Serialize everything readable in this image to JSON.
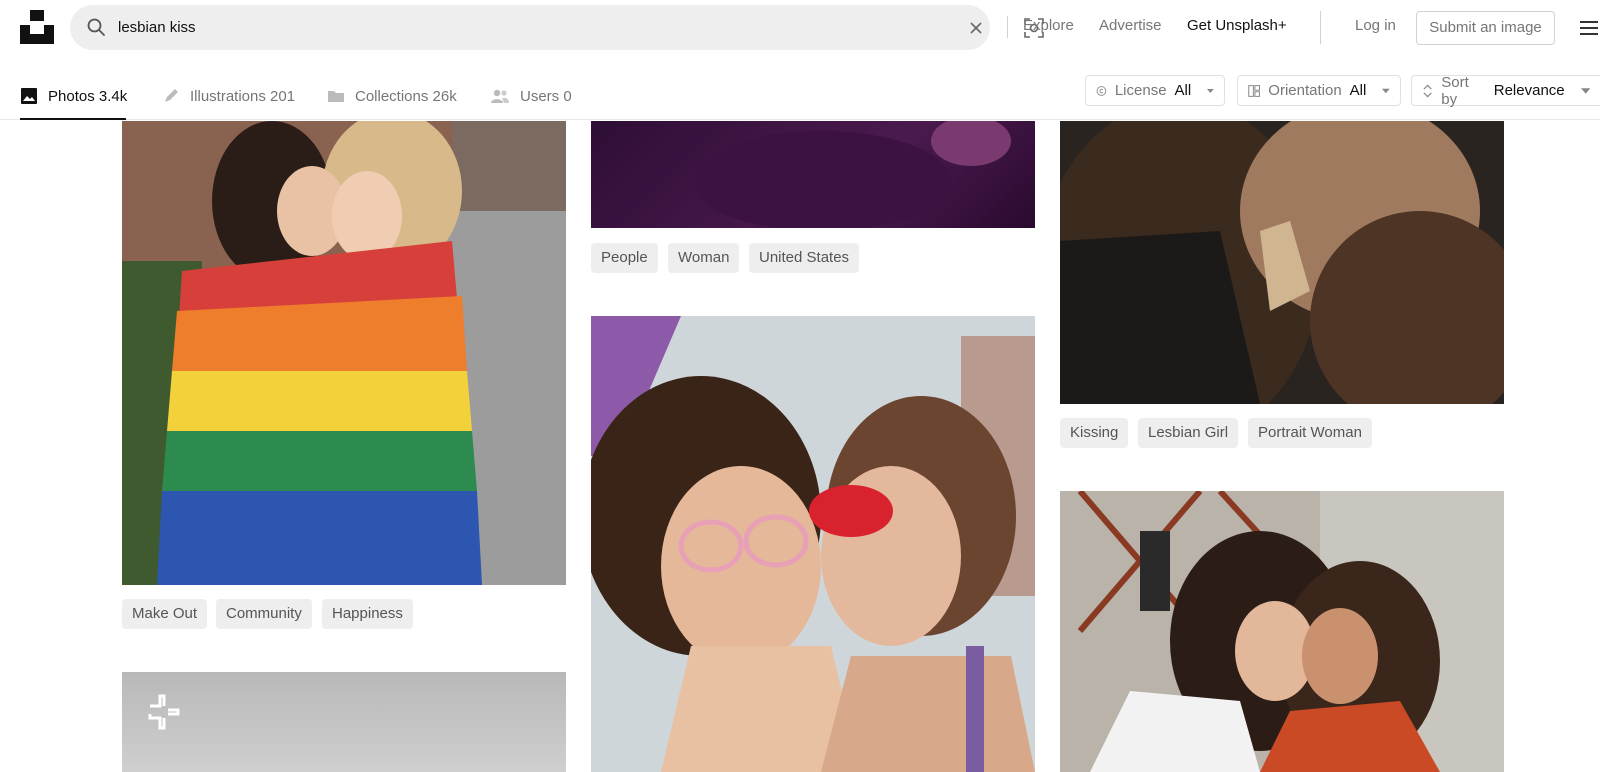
{
  "search": {
    "query": "lesbian kiss"
  },
  "nav": {
    "explore": "Explore",
    "advertise": "Advertise",
    "get_plus": "Get Unsplash+",
    "login": "Log in",
    "submit": "Submit an image"
  },
  "tabs": [
    {
      "label": "Photos 3.4k",
      "icon": "image-icon"
    },
    {
      "label": "Illustrations 201",
      "icon": "pen-icon"
    },
    {
      "label": "Collections 26k",
      "icon": "folder-icon"
    },
    {
      "label": "Users 0",
      "icon": "users-icon"
    }
  ],
  "filters": {
    "license": {
      "label": "License",
      "value": "All"
    },
    "orientation": {
      "label": "Orientation",
      "value": "All"
    },
    "sort": {
      "label": "Sort by",
      "value": "Relevance"
    }
  },
  "columns": {
    "col1": {
      "tags": [
        "Make Out",
        "Community",
        "Happiness"
      ]
    },
    "col2": {
      "tags": [
        "People",
        "Woman",
        "United States"
      ]
    },
    "col3": {
      "tags": [
        "Kissing",
        "Lesbian Girl",
        "Portrait Woman"
      ]
    }
  },
  "colors": {
    "accent": "#111111",
    "muted_text": "#767676",
    "tag_bg": "#eeeeee"
  }
}
